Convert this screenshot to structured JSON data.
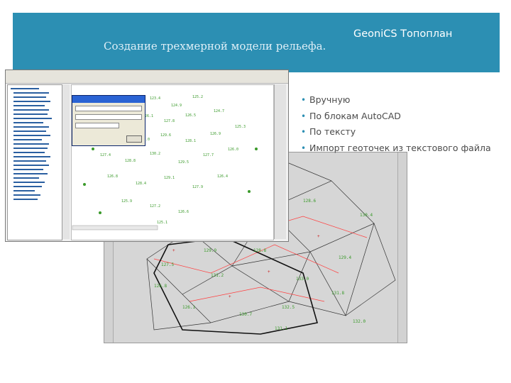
{
  "slide": {
    "title": "Создание трехмерной модели рельефа.",
    "app_name": "GeoniCS Топоплан"
  },
  "bullets": [
    "Вручную",
    "По блокам AutoCAD",
    "По тексту",
    "Импорт геоточек из текстового файла"
  ],
  "colors": {
    "title_band": "#2c8fb3",
    "bullet_marker": "#2c8fb3",
    "bullet_text": "#4b4b4b",
    "point_labels": "#3a9a2a",
    "triangulation_lines": "#333333",
    "dialog_caption": "#2a63d4"
  },
  "screenshots": [
    {
      "name": "autocad-window-with-geopoints",
      "icon": "screenshot-image"
    },
    {
      "name": "triangulation-surface-view",
      "icon": "screenshot-image"
    }
  ]
}
